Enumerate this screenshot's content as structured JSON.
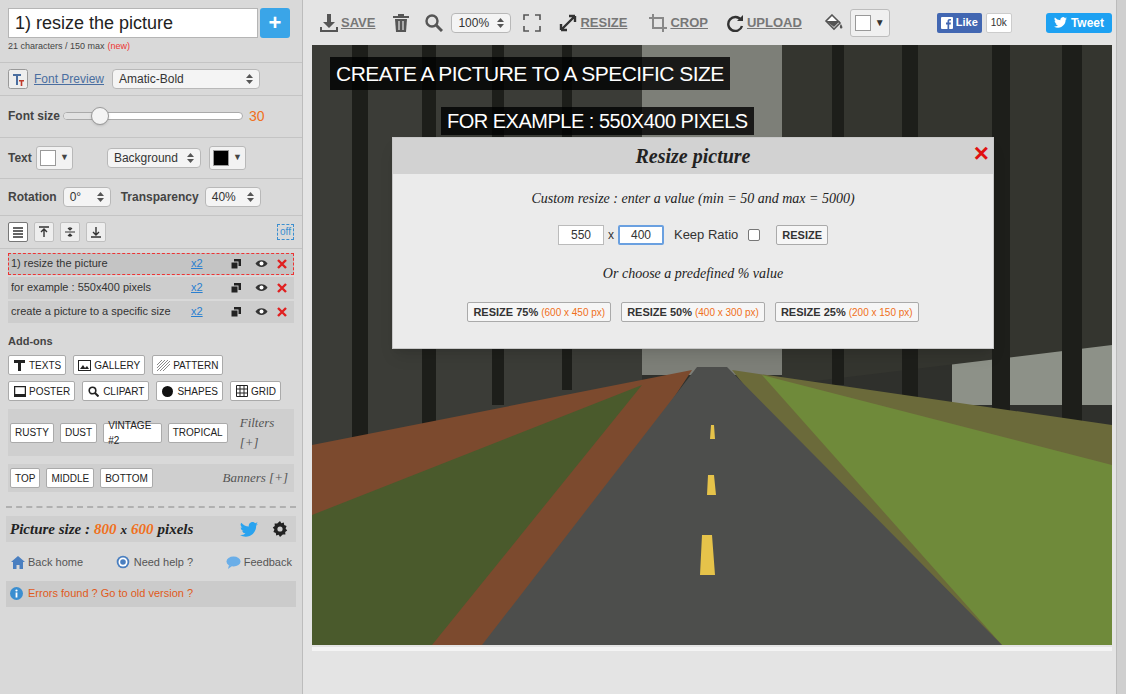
{
  "sidebar": {
    "text_input": {
      "value": "1) resize the picture",
      "add": "+"
    },
    "counter": {
      "text": "21 characters / 150 max",
      "badge": "(new)"
    },
    "font": {
      "label": "Font Preview",
      "value": "Amatic-Bold"
    },
    "font_size": {
      "label": "Font size",
      "level": 0.2,
      "reading": "30"
    },
    "colors": {
      "text_label": "Text",
      "text_color": "#ffffff",
      "background_label": "Background",
      "background_color": "#000000",
      "arrow": "▼"
    },
    "rotation": {
      "label": "Rotation",
      "value": "0°"
    },
    "transparency": {
      "label": "Transparency",
      "value": "40%"
    },
    "alignments": [
      {
        "selected": true
      },
      {
        "selected": false
      },
      {
        "selected": false
      },
      {
        "selected": false
      }
    ],
    "toggle": "off",
    "layers": [
      {
        "label": "1) resize the picture",
        "copies": "x2",
        "selected": true
      },
      {
        "label": "for example : 550x400 pixels",
        "copies": "x2",
        "selected": false
      },
      {
        "label": "create a picture to a specific size",
        "copies": "x2",
        "selected": false
      }
    ],
    "addons": {
      "label": "Add-ons",
      "buttons": [
        "TEXTS",
        "GALLERY",
        "PATTERN",
        "POSTER",
        "CLIPART",
        "SHAPES",
        "GRID"
      ]
    },
    "filters": {
      "buttons": [
        "RUSTY",
        "DUST",
        "VINTAGE #2",
        "TROPICAL"
      ],
      "more": "Filters [+]"
    },
    "banners": {
      "buttons": [
        "TOP",
        "MIDDLE",
        "BOTTOM"
      ],
      "more": "Banners [+]"
    },
    "picture_size": {
      "label": "Picture size :",
      "width": "800",
      "x": "x",
      "height": "600",
      "unit": "pixels"
    },
    "links": [
      "Back home",
      "Need help ?",
      "Feedback"
    ],
    "error": "Errors found ? Go to old version ?"
  },
  "toolbar": {
    "save": "SAVE",
    "zoom": "100%",
    "resize": "RESIZE",
    "crop": "CROP",
    "upload": "UPLOAD",
    "fill_color": "#ffffff",
    "arrow": "▼",
    "like": "Like",
    "like_count": "10k",
    "tweet": "Tweet"
  },
  "canvas": {
    "texts": [
      "CREATE A PICTURE TO A SPECIFIC SIZE",
      "FOR EXAMPLE : 550X400 PIXELS"
    ]
  },
  "modal": {
    "title": "Resize picture",
    "close": "×",
    "instruction": "Custom resize : enter a value (min = 50 and max = 5000)",
    "width": "550",
    "times": "x",
    "height": "400",
    "keep_ratio": {
      "label": "Keep Ratio",
      "checked": false
    },
    "button": "RESIZE",
    "predefined": "Or choose a predefined % value",
    "presets": [
      {
        "label": "RESIZE 75%",
        "size": "(600 x 450 px)"
      },
      {
        "label": "RESIZE 50%",
        "size": "(400 x 300 px)"
      },
      {
        "label": "RESIZE 25%",
        "size": "(200 x 150 px)"
      }
    ]
  }
}
